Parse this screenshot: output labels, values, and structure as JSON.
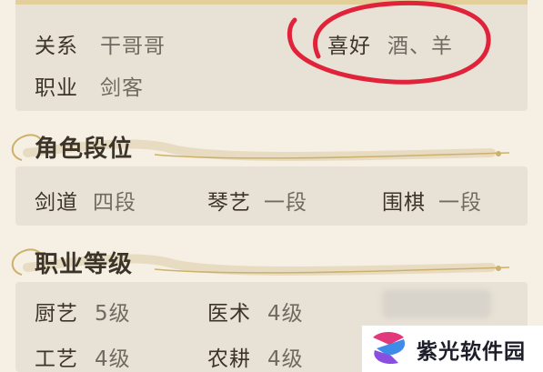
{
  "profile": {
    "relation_label": "关系",
    "relation_value": "干哥哥",
    "hobby_label": "喜好",
    "hobby_value": "酒、羊",
    "job_label": "职业",
    "job_value": "剑客"
  },
  "rank_section": {
    "title": "角色段位",
    "items": [
      {
        "label": "剑道",
        "value": "四段"
      },
      {
        "label": "琴艺",
        "value": "一段"
      },
      {
        "label": "围棋",
        "value": "一段"
      }
    ]
  },
  "job_level_section": {
    "title": "职业等级",
    "items": [
      {
        "label": "厨艺",
        "value": "5级"
      },
      {
        "label": "医术",
        "value": "4级"
      },
      {
        "label": "工艺",
        "value": "4级"
      },
      {
        "label": "农耕",
        "value": "4级"
      }
    ]
  },
  "watermark": {
    "text": "紫光软件园"
  },
  "colors": {
    "background": "#f6f0e4",
    "panel": "#e8e2d6",
    "annotation": "#e0233a",
    "gold": "#d8bf7f"
  }
}
